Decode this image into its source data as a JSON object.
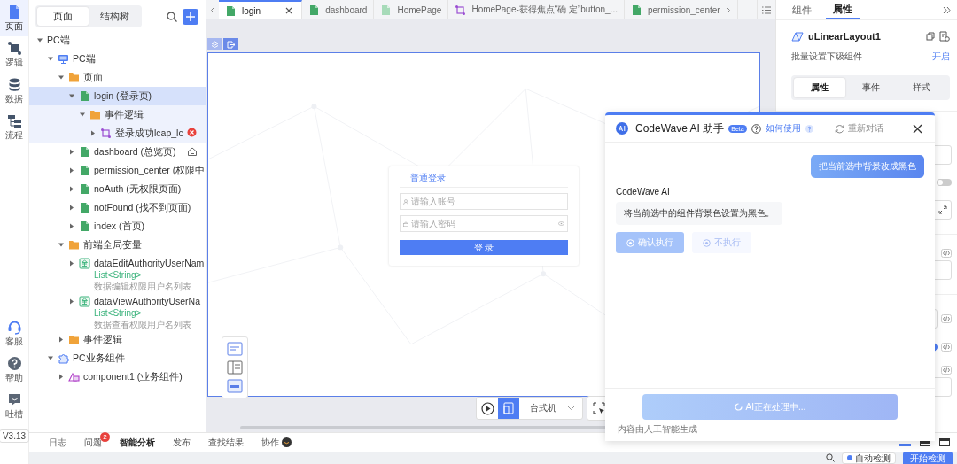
{
  "rail": {
    "top": [
      {
        "label": "页面",
        "kind": "page",
        "selected": true
      },
      {
        "label": "逻辑",
        "kind": "logic",
        "selected": false
      },
      {
        "label": "数据",
        "kind": "data",
        "selected": false
      },
      {
        "label": "流程",
        "kind": "flow",
        "selected": false
      }
    ],
    "bottom": [
      {
        "label": "客服",
        "kind": "support"
      },
      {
        "label": "帮助",
        "kind": "help"
      },
      {
        "label": "吐槽",
        "kind": "feedback"
      }
    ],
    "version": "V3.13"
  },
  "left_panel": {
    "tabs": [
      {
        "label": "页面",
        "selected": true
      },
      {
        "label": "结构树",
        "selected": false
      }
    ],
    "tree": [
      {
        "label": "PC端",
        "expanded": true,
        "selected": false,
        "children": [
          {
            "label": "PC端",
            "kind": "platform",
            "expanded": true,
            "selected": false,
            "children": [
              {
                "label": "页面",
                "kind": "folder",
                "expanded": true,
                "selected": false,
                "children": [
                  {
                    "label": "login (登录页)",
                    "kind": "page",
                    "expanded": true,
                    "selected": true,
                    "children": [
                      {
                        "label": "事件逻辑",
                        "kind": "folder",
                        "expanded": true,
                        "selected": false,
                        "children": [
                          {
                            "label": "登录成功lcap_lc",
                            "kind": "logic",
                            "expanded": false,
                            "selected": false,
                            "error": true
                          }
                        ]
                      }
                    ]
                  },
                  {
                    "label": "dashboard (总览页)",
                    "kind": "page",
                    "expanded": false,
                    "selected": false,
                    "home": true
                  },
                  {
                    "label": "permission_center (权限中",
                    "kind": "page",
                    "expanded": false,
                    "selected": false
                  },
                  {
                    "label": "noAuth (无权限页面)",
                    "kind": "page",
                    "expanded": false,
                    "selected": false
                  },
                  {
                    "label": "notFound (找不到页面)",
                    "kind": "page",
                    "expanded": false,
                    "selected": false
                  },
                  {
                    "label": "index (首页)",
                    "kind": "page",
                    "expanded": false,
                    "selected": false
                  }
                ]
              },
              {
                "label": "前端全局变量",
                "kind": "folder",
                "expanded": true,
                "selected": false,
                "children": [
                  {
                    "label": "dataEditAuthorityUserNam",
                    "kind": "variable",
                    "type": "List<String>",
                    "description": "数据编辑权限用户名列表",
                    "expanded": false,
                    "selected": false
                  },
                  {
                    "label": "dataViewAuthorityUserNa",
                    "kind": "variable",
                    "type": "List<String>",
                    "description": "数据查看权限用户名列表",
                    "expanded": false,
                    "selected": false
                  }
                ]
              },
              {
                "label": "事件逻辑",
                "kind": "folder",
                "expanded": false,
                "selected": false
              }
            ]
          },
          {
            "label": "PC业务组件",
            "kind": "component-group",
            "expanded": true,
            "selected": false,
            "children": [
              {
                "label": "component1 (业务组件)",
                "kind": "component",
                "expanded": false,
                "selected": false
              }
            ]
          }
        ]
      }
    ]
  },
  "editor_tabs": [
    {
      "label": "login",
      "kind": "page",
      "selected": true
    },
    {
      "label": "dashboard",
      "kind": "page",
      "selected": false
    },
    {
      "label": "HomePage",
      "kind": "page-light",
      "selected": false
    },
    {
      "label": "HomePage-获得焦点“确 定”button_...",
      "kind": "logic",
      "selected": false
    },
    {
      "label": "permission_center",
      "kind": "page",
      "selected": false
    }
  ],
  "canvas": {
    "login_form": {
      "tab": "普通登录",
      "account_placeholder": "请输入账号",
      "password_placeholder": "请输入密码",
      "submit": "登 录"
    },
    "device": "台式机"
  },
  "right_panel": {
    "tabs": [
      {
        "label": "组件",
        "selected": false
      },
      {
        "label": "属性",
        "selected": true
      }
    ],
    "component_name": "uLinearLayout1",
    "batch_label": "批量设置下级组件",
    "batch_link": "开启",
    "sections": [
      {
        "label": "属性",
        "selected": true
      },
      {
        "label": "事件",
        "selected": false
      },
      {
        "label": "样式",
        "selected": false
      }
    ],
    "form": [
      {
        "kind": "field"
      },
      {
        "kind": "toggle",
        "on": false
      },
      {
        "kind": "expand-field"
      },
      {
        "kind": "divider"
      },
      {
        "kind": "code-field"
      },
      {
        "kind": "divider"
      },
      {
        "kind": "code-select"
      },
      {
        "kind": "code-radio",
        "checked": true
      },
      {
        "kind": "code-field"
      }
    ]
  },
  "ai_assistant": {
    "title": "CodeWave AI 助手",
    "badge": "Beta",
    "help_link": "如何使用",
    "restart": "重新对话",
    "messages": [
      {
        "kind": "user",
        "text": "把当前选中背景改成黑色"
      },
      {
        "kind": "ai",
        "sender": "CodeWave AI",
        "text": "将当前选中的组件背景色设置为黑色。",
        "actions": [
          {
            "label": "确认执行",
            "kind": "primary"
          },
          {
            "label": "不执行",
            "kind": "secondary"
          }
        ]
      }
    ],
    "processing": "AI正在处理中...",
    "footnote": "内容由人工智能生成"
  },
  "bottom_tabs": [
    {
      "label": "日志",
      "selected": false,
      "has_icon": false
    },
    {
      "label": "问题",
      "selected": false,
      "has_icon": false,
      "badge": "2"
    },
    {
      "label": "智能分析",
      "selected": true,
      "has_icon": false
    },
    {
      "label": "发布",
      "selected": false,
      "has_icon": false
    },
    {
      "label": "查找结果",
      "selected": false,
      "has_icon": false
    },
    {
      "label": "协作",
      "selected": false,
      "has_icon": true
    }
  ],
  "status_bar": {
    "auto_check": "自动检测",
    "start_check": "开始检测"
  }
}
